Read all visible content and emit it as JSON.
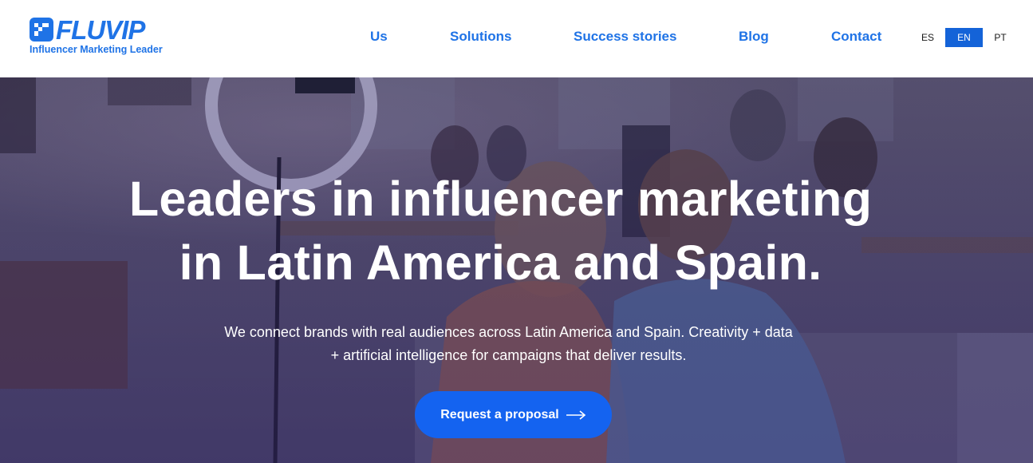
{
  "brand": {
    "name": "FLUVIP",
    "tagline": "Influencer Marketing Leader",
    "color": "#1f73e6"
  },
  "nav": {
    "items": [
      {
        "label": "Us"
      },
      {
        "label": "Solutions"
      },
      {
        "label": "Success stories"
      },
      {
        "label": "Blog"
      },
      {
        "label": "Contact"
      }
    ]
  },
  "languages": {
    "items": [
      {
        "label": "ES",
        "active": false
      },
      {
        "label": "EN",
        "active": true
      },
      {
        "label": "PT",
        "active": false
      }
    ],
    "active_color": "#1463d8"
  },
  "hero": {
    "title_line1": "Leaders in influencer marketing",
    "title_line2": "in Latin America and Spain.",
    "subtitle_line1": "We connect brands with real audiences across Latin America and Spain. Creativity + data",
    "subtitle_line2": "+ artificial intelligence for campaigns that deliver results.",
    "cta_label": "Request a proposal",
    "cta_icon": "arrow-right-icon",
    "cta_color": "#1463f0"
  }
}
